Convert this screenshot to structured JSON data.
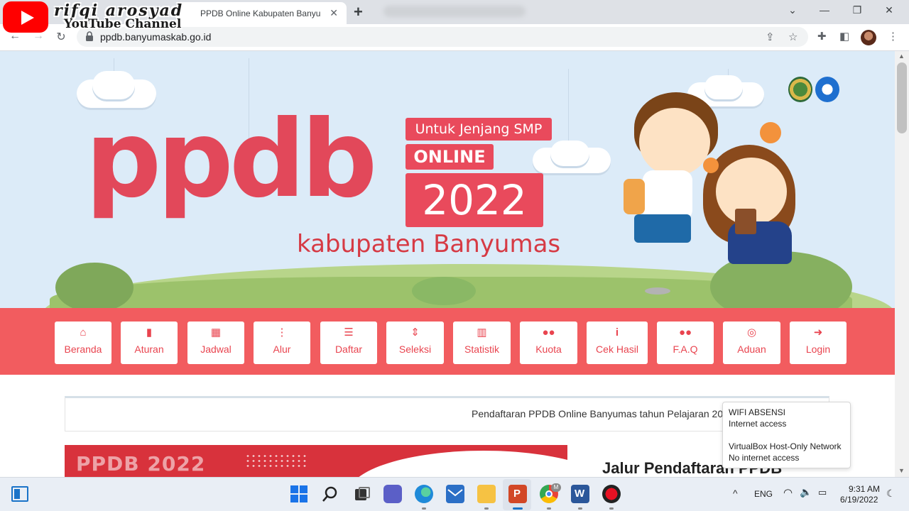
{
  "browser": {
    "tab_title": "PPDB Online Kabupaten Banyumas",
    "url": "ppdb.banyumaskab.go.id"
  },
  "watermark": {
    "name": "rifqi arosyad",
    "channel": "YouTube Channel"
  },
  "banner": {
    "logo_main": "ppdb",
    "logo_subtitle": "Untuk Jenjang SMP",
    "logo_online": "ONLINE",
    "logo_year": "2022",
    "logo_region": "kabupaten Banyumas"
  },
  "nav": {
    "items": [
      {
        "label": "Beranda",
        "icon": "home-icon",
        "glyph": "⌂"
      },
      {
        "label": "Aturan",
        "icon": "book-icon",
        "glyph": "▮"
      },
      {
        "label": "Jadwal",
        "icon": "calendar-icon",
        "glyph": "▦"
      },
      {
        "label": "Alur",
        "icon": "ellipsis-vertical-icon",
        "glyph": "⋮"
      },
      {
        "label": "Daftar",
        "icon": "list-icon",
        "glyph": "☰"
      },
      {
        "label": "Seleksi",
        "icon": "sort-icon",
        "glyph": "⇕"
      },
      {
        "label": "Statistik",
        "icon": "bar-chart-icon",
        "glyph": "▥"
      },
      {
        "label": "Kuota",
        "icon": "users-icon",
        "glyph": "●●"
      },
      {
        "label": "Cek Hasil",
        "icon": "info-icon",
        "glyph": "i"
      },
      {
        "label": "F.A.Q",
        "icon": "users-icon",
        "glyph": "●●"
      },
      {
        "label": "Aduan",
        "icon": "lifebuoy-icon",
        "glyph": "◎"
      },
      {
        "label": "Login",
        "icon": "sign-in-icon",
        "glyph": "➜"
      }
    ]
  },
  "content": {
    "marquee": "Pendaftaran PPDB Online Banyumas tahun Pelajaran 20",
    "promo_text": "PPDB 2022",
    "section_title": "Jalur Pendaftaran PPDB"
  },
  "network_popup": {
    "net1_name": "WIFI ABSENSI",
    "net1_status": "Internet access",
    "net2_name": "VirtualBox Host-Only Network",
    "net2_status": "No internet access"
  },
  "taskbar": {
    "language": "ENG",
    "time": "9:31 AM",
    "date": "6/19/2022"
  },
  "colors": {
    "accent": "#f25c5f",
    "accent_text": "#e9444f",
    "banner_bg": "#dcebf8"
  }
}
